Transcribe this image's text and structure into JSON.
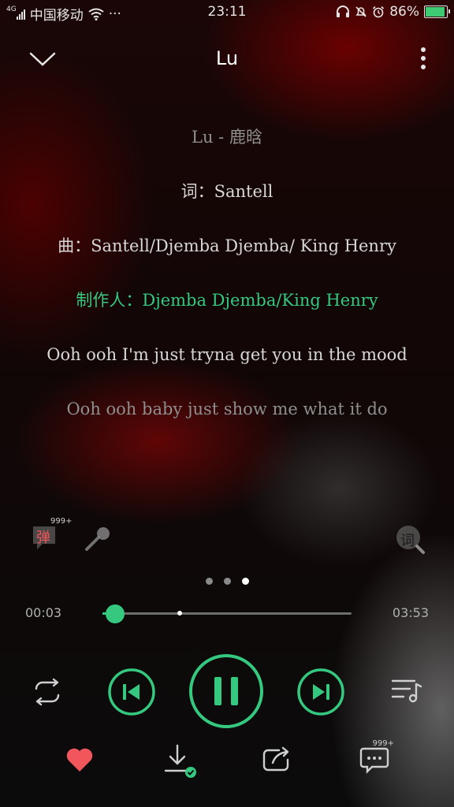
{
  "status_bar": {
    "network": "4G",
    "carrier": "中国移动",
    "more": "···",
    "time": "23:11",
    "battery": "86%"
  },
  "header": {
    "title": "Lu"
  },
  "lyrics": [
    "Lu - 鹿晗",
    "词：Santell",
    "曲：Santell/Djemba Djemba/ King Henry",
    "制作人：Djemba Djemba/King Henry",
    "Ooh ooh I'm just tryna get you in the mood",
    "Ooh ooh baby just show me what it do"
  ],
  "tools": {
    "danmu_label": "弹",
    "danmu_count": "999+",
    "lyric_label": "词"
  },
  "player": {
    "current_time": "00:03",
    "duration": "03:53",
    "progress": 0.05,
    "buffered": 0.31,
    "page_count": 3,
    "active_page": 3
  },
  "bottom_bar": {
    "comment_count": "999+"
  },
  "colors": {
    "accent": "#35c980",
    "like": "#f0565b"
  }
}
